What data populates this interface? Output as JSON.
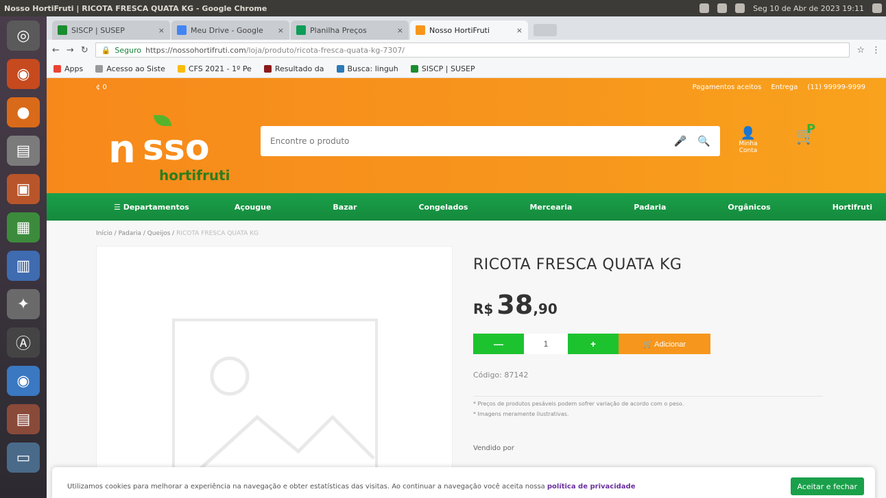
{
  "os": {
    "window_title": "Nosso HortiFruti | RICOTA FRESCA QUATA KG - Google Chrome",
    "clock": "Seg 10 de Abr de 2023 19:11"
  },
  "browser": {
    "tabs": [
      {
        "label": "SISCP | SUSEP",
        "color": "#1a8d2f"
      },
      {
        "label": "Meu Drive - Google",
        "color": "#4285f4"
      },
      {
        "label": "Planilha Preços",
        "color": "#0f9d58"
      },
      {
        "label": "Nosso HortiFruti",
        "color": "#f7961c"
      }
    ],
    "url_secure": "Seguro",
    "url_host": "https://nossohortifruti.com",
    "url_path": "/loja/produto/ricota-fresca-quata-kg-7307/",
    "bookmarks": [
      {
        "label": "Apps",
        "color": "#ea4335"
      },
      {
        "label": "Acesso ao Siste",
        "color": "#999999"
      },
      {
        "label": "CFS 2021 - 1º Pe",
        "color": "#fbbc05"
      },
      {
        "label": "Resultado da",
        "color": "#8b1a1a"
      },
      {
        "label": "Busca: linguh",
        "color": "#2a7ab8"
      },
      {
        "label": "SISCP | SUSEP",
        "color": "#1a8d2f"
      }
    ]
  },
  "site": {
    "util_left": "¢ 0",
    "util_links": [
      "Pagamentos aceitos",
      "Entrega",
      "(11) 99999-9999"
    ],
    "logo": {
      "prefix": "n",
      "suffix": "sso",
      "sub": "hortifruti"
    },
    "search_placeholder": "Encontre o produto",
    "account_label": "Minha Conta",
    "cart_badge": "P",
    "dept_label": "☰ Departamentos",
    "categories": [
      "Açougue",
      "Bazar",
      "Congelados",
      "Mercearia",
      "Padaria",
      "Orgânicos",
      "Hortifruti"
    ],
    "breadcrumb": {
      "path": "Início / Padaria / Queijos / ",
      "current": "RICOTA FRESCA QUATA KG"
    }
  },
  "product": {
    "name": "RICOTA FRESCA QUATA KG",
    "price_currency": "R$",
    "price_integer": "38",
    "price_decimal": ",90",
    "qty": "1",
    "minus_label": "—",
    "plus_label": "+",
    "add_label": "🛒 Adicionar",
    "code": "Código: 87142",
    "notes": [
      "* Preços de produtos pesáveis podem sofrer variação de acordo com o peso.",
      "* Imagens meramente ilustrativas."
    ],
    "sold": "Vendido por"
  },
  "cookie": {
    "text": "Utilizamos cookies para melhorar a experiência na navegação e obter estatísticas das visitas. Ao continuar a navegação você aceita nossa",
    "link": "política de privacidade",
    "accept": "Aceitar e fechar"
  }
}
